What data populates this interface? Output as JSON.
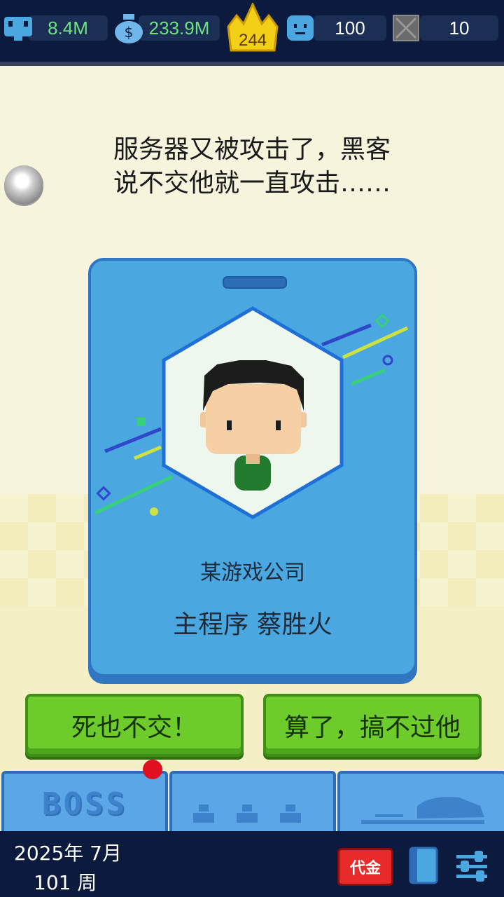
{
  "stats": {
    "fans": "8.4M",
    "money": "233.9M",
    "rank": "244",
    "employees": "100",
    "unknown": "10"
  },
  "message": {
    "line1": "服务器又被攻击了，黑客",
    "line2": "说不交他就一直攻击……"
  },
  "card": {
    "company": "某游戏公司",
    "name": "主程序 蔡胜火"
  },
  "choices": {
    "left": "死也不交！",
    "right": "算了，搞不过他"
  },
  "tabs": {
    "boss": "BOSS"
  },
  "date": {
    "year_month": "2025年 7月",
    "week": "101 周"
  },
  "buttons": {
    "voucher": "代金"
  },
  "colors": {
    "top_bar": "#0c1a3e",
    "card_blue": "#4aa7e0",
    "choice_green": "#6dcb2b",
    "stat_green": "#6de37d",
    "stat_white": "#ffffff"
  },
  "icons": [
    "monitor-icon",
    "money-bag-icon",
    "crown-icon",
    "employee-icon",
    "locked-icon",
    "book-icon",
    "settings-sliders-icon"
  ]
}
